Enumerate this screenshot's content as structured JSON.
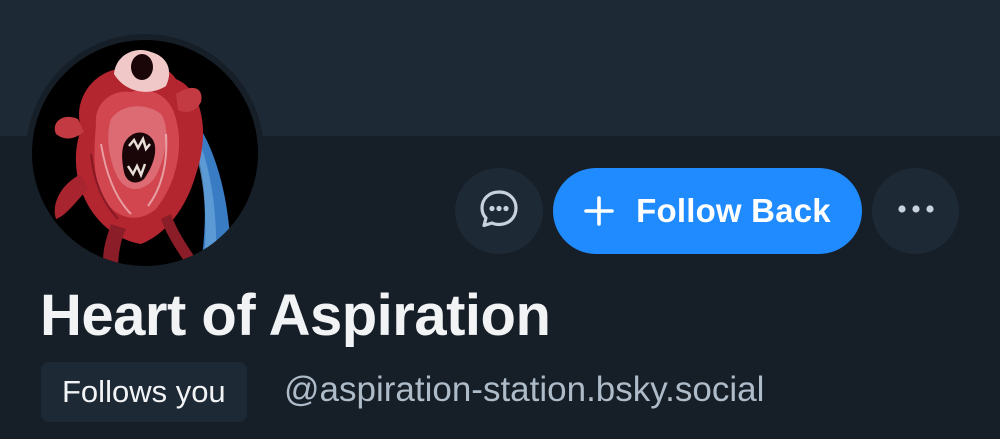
{
  "profile": {
    "display_name": "Heart of Aspiration",
    "follows_badge": "Follows you",
    "handle": "@aspiration-station.bsky.social"
  },
  "actions": {
    "message_icon": "chat-bubble-icon",
    "follow_label": "Follow Back",
    "follow_icon": "plus-icon",
    "more_icon": "ellipsis-icon"
  },
  "colors": {
    "accent": "#208bfe",
    "background": "#161e27",
    "banner": "#1e2936",
    "text": "#f1f3f5",
    "muted_text": "#aebbc9"
  }
}
